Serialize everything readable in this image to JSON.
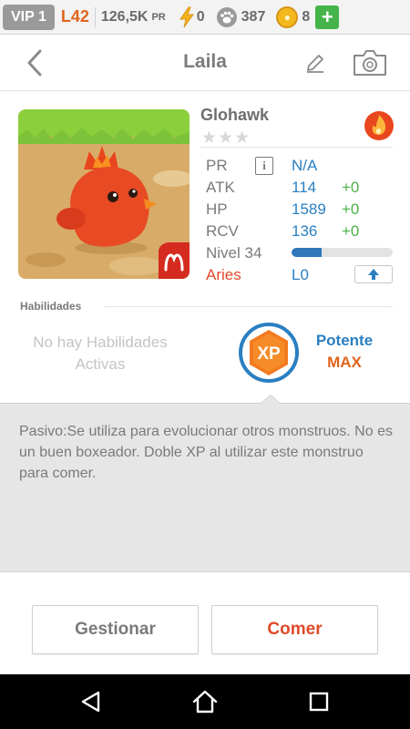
{
  "topbar": {
    "vip": "VIP 1",
    "level": "L42",
    "pr_value": "126,5K",
    "pr_unit": "PR",
    "energy": "0",
    "paws": "387",
    "coins": "8",
    "add_label": "+",
    "colors": {
      "level": "#e0641c",
      "energy": "#f3b21b",
      "coin": "#f2b81d",
      "add": "#44b44a"
    }
  },
  "header": {
    "title": "Laila",
    "back_icon": "chevron-left-icon",
    "edit_icon": "pencil-icon",
    "camera_icon": "camera-icon"
  },
  "monster": {
    "name": "Glohawk",
    "stars_filled": 0,
    "stars_total": 3,
    "element_icon": "fire-icon",
    "sign_icon": "aries-icon",
    "stats": [
      {
        "label": "PR",
        "value": "N/A",
        "bonus": ""
      },
      {
        "label": "ATK",
        "value": "114",
        "bonus": "+0"
      },
      {
        "label": "HP",
        "value": "1589",
        "bonus": "+0"
      },
      {
        "label": "RCV",
        "value": "136",
        "bonus": "+0"
      }
    ],
    "info_symbol": "i",
    "level_label": "Nivel 34",
    "level_progress": 0.3,
    "sign_label": "Aries",
    "sign_level": "L0",
    "upgrade_icon": "arrow-up-icon"
  },
  "abilities": {
    "title": "Habilidades",
    "none_text": "No hay Habilidades Activas",
    "xp_badge_text": "XP",
    "passive_name": "Potente",
    "passive_level": "MAX"
  },
  "description": {
    "text": "Pasivo:Se utiliza para evolucionar otros monstruos. No es un buen boxeador. Doble XP al utilizar este monstruo para comer."
  },
  "actions": {
    "manage": "Gestionar",
    "eat": "Comer"
  },
  "navbar": {
    "back_icon": "triangle-back-icon",
    "home_icon": "home-icon",
    "recents_icon": "recents-icon"
  }
}
